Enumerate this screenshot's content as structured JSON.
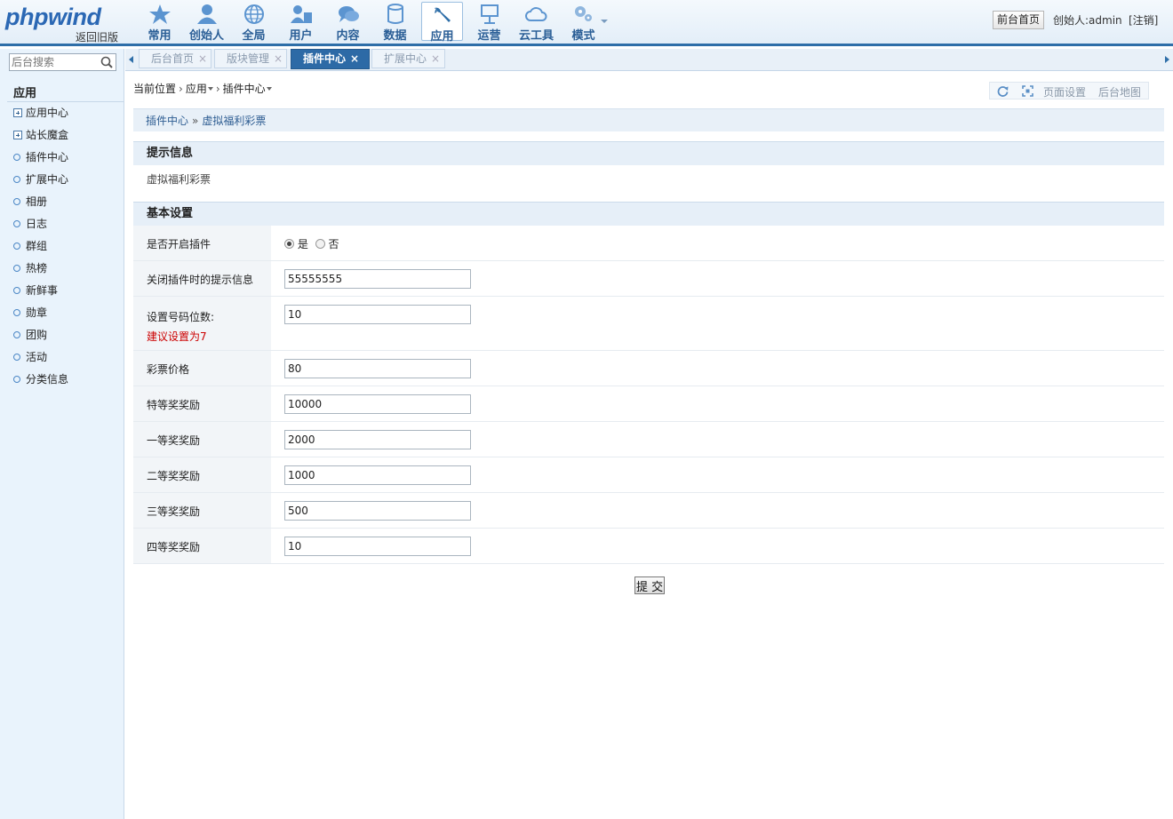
{
  "header": {
    "logo": "phpwind",
    "logo_sub": "返回旧版",
    "nav": [
      {
        "label": "常用",
        "icon": "star-icon"
      },
      {
        "label": "创始人",
        "icon": "person-icon"
      },
      {
        "label": "全局",
        "icon": "globe-icon"
      },
      {
        "label": "用户",
        "icon": "users-icon"
      },
      {
        "label": "内容",
        "icon": "chat-icon"
      },
      {
        "label": "数据",
        "icon": "database-icon"
      },
      {
        "label": "应用",
        "icon": "wrench-icon",
        "active": true
      },
      {
        "label": "运营",
        "icon": "signboard-icon"
      },
      {
        "label": "云工具",
        "icon": "cloud-icon"
      },
      {
        "label": "模式",
        "icon": "gears-icon"
      }
    ],
    "front_button": "前台首页",
    "user_info": "创始人:admin",
    "logout": "[注销]"
  },
  "sidebar": {
    "search_placeholder": "后台搜索",
    "title": "应用",
    "items": [
      {
        "label": "应用中心",
        "expandable": true
      },
      {
        "label": "站长魔盒",
        "expandable": true
      },
      {
        "label": "插件中心"
      },
      {
        "label": "扩展中心"
      },
      {
        "label": "相册"
      },
      {
        "label": "日志"
      },
      {
        "label": "群组"
      },
      {
        "label": "热榜"
      },
      {
        "label": "新鲜事"
      },
      {
        "label": "勋章"
      },
      {
        "label": "团购"
      },
      {
        "label": "活动"
      },
      {
        "label": "分类信息"
      }
    ]
  },
  "tabs": [
    {
      "label": "后台首页",
      "close": "×"
    },
    {
      "label": "版块管理",
      "close": "×"
    },
    {
      "label": "插件中心",
      "close": "×",
      "active": true
    },
    {
      "label": "扩展中心",
      "close": "×"
    }
  ],
  "breadcrumb": {
    "prefix": "当前位置",
    "level1": "应用",
    "level2": "插件中心"
  },
  "toolbar": {
    "page_settings": "页面设置",
    "admin_map": "后台地图"
  },
  "subnav": {
    "parent": "插件中心",
    "separator": "»",
    "current": "虚拟福利彩票"
  },
  "tip_section": {
    "title": "提示信息",
    "text": "虚拟福利彩票"
  },
  "settings_section": {
    "title": "基本设置",
    "enable_label": "是否开启插件",
    "enable_yes": "是",
    "enable_no": "否",
    "enable_value": "是",
    "rows": [
      {
        "label": "关闭插件时的提示信息",
        "value": "55555555"
      },
      {
        "label": "设置号码位数:",
        "hint": "建议设置为7",
        "value": "10"
      },
      {
        "label": "彩票价格",
        "value": "80"
      },
      {
        "label": "特等奖奖励",
        "value": "10000"
      },
      {
        "label": "一等奖奖励",
        "value": "2000"
      },
      {
        "label": "二等奖奖励",
        "value": "1000"
      },
      {
        "label": "三等奖奖励",
        "value": "500"
      },
      {
        "label": "四等奖奖励",
        "value": "10"
      }
    ]
  },
  "submit_label": "提 交",
  "colors": {
    "brand_blue": "#2b68b4",
    "header_border": "#2e6ea8",
    "active_tab": "#2d6aa6",
    "sidebar_bg": "#e9f3fc",
    "hint_red": "#cc0000"
  }
}
